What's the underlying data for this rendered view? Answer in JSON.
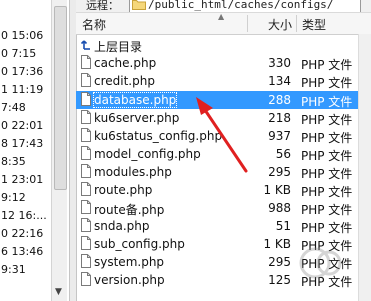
{
  "left_pane": {
    "rows": [
      {
        "text": "0 15:06"
      },
      {
        "text": "0 7:15"
      },
      {
        "text": "0 17:36"
      },
      {
        "text": "1 11:19"
      },
      {
        "text": "7:48"
      },
      {
        "text": "0 22:01"
      },
      {
        "text": "8 17:43"
      },
      {
        "text": "8:35"
      },
      {
        "text": "1 23:01"
      },
      {
        "text": "9:12"
      },
      {
        "text": "12 16:..."
      },
      {
        "text": "0 22:16"
      },
      {
        "text": "6 13:46"
      },
      {
        "text": "9:31"
      }
    ]
  },
  "path_bar": {
    "label": "远程：",
    "path": "/public_html/caches/configs/"
  },
  "header": {
    "name": "名称",
    "size": "大小",
    "type": "类型"
  },
  "files": [
    {
      "name": "上层目录",
      "size": "",
      "type": "",
      "icon": "parent-folder-icon"
    },
    {
      "name": "cache.php",
      "size": "330",
      "type": "PHP 文件",
      "icon": "file-icon"
    },
    {
      "name": "credit.php",
      "size": "134",
      "type": "PHP 文件",
      "icon": "file-icon"
    },
    {
      "name": "database.php",
      "size": "288",
      "type": "PHP 文件",
      "icon": "file-icon",
      "selected": true
    },
    {
      "name": "ku6server.php",
      "size": "218",
      "type": "PHP 文件",
      "icon": "file-icon"
    },
    {
      "name": "ku6status_config.php",
      "size": "937",
      "type": "PHP 文件",
      "icon": "file-icon"
    },
    {
      "name": "model_config.php",
      "size": "56",
      "type": "PHP 文件",
      "icon": "file-icon"
    },
    {
      "name": "modules.php",
      "size": "295",
      "type": "PHP 文件",
      "icon": "file-icon"
    },
    {
      "name": "route.php",
      "size": "1 KB",
      "type": "PHP 文件",
      "icon": "file-icon"
    },
    {
      "name": "route备.php",
      "size": "988",
      "type": "PHP 文件",
      "icon": "file-icon"
    },
    {
      "name": "snda.php",
      "size": "51",
      "type": "PHP 文件",
      "icon": "file-icon"
    },
    {
      "name": "sub_config.php",
      "size": "1 KB",
      "type": "PHP 文件",
      "icon": "file-icon"
    },
    {
      "name": "system.php",
      "size": "295",
      "type": "PHP 文件",
      "icon": "file-icon"
    },
    {
      "name": "version.php",
      "size": "125",
      "type": "PHP 文件",
      "icon": "file-icon"
    }
  ],
  "colors": {
    "selection": "#3399ff",
    "annotation_arrow": "#e02020"
  }
}
